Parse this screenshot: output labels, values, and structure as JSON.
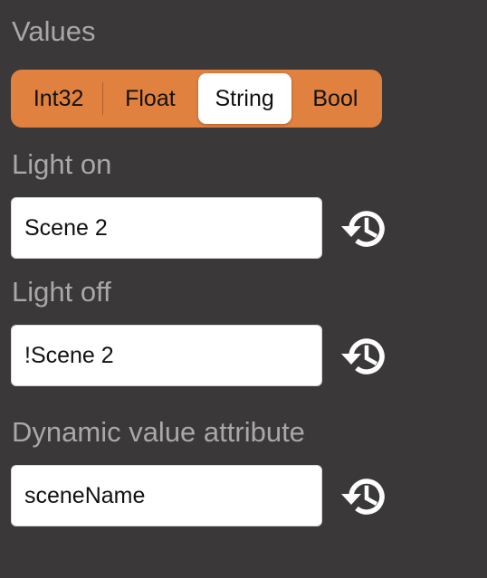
{
  "values_section": {
    "title": "Values",
    "segments": [
      "Int32",
      "Float",
      "String",
      "Bool"
    ],
    "selected": "String"
  },
  "light_on": {
    "label": "Light on",
    "value": "Scene 2",
    "reset_icon": "history-icon"
  },
  "light_off": {
    "label": "Light off",
    "value": "!Scene 2",
    "reset_icon": "history-icon"
  },
  "dynamic_value": {
    "label": "Dynamic value attribute",
    "value": "sceneName",
    "reset_icon": "history-icon"
  },
  "colors": {
    "background": "#3a3839",
    "accent": "#e0813f",
    "label": "#a9a7a8"
  }
}
